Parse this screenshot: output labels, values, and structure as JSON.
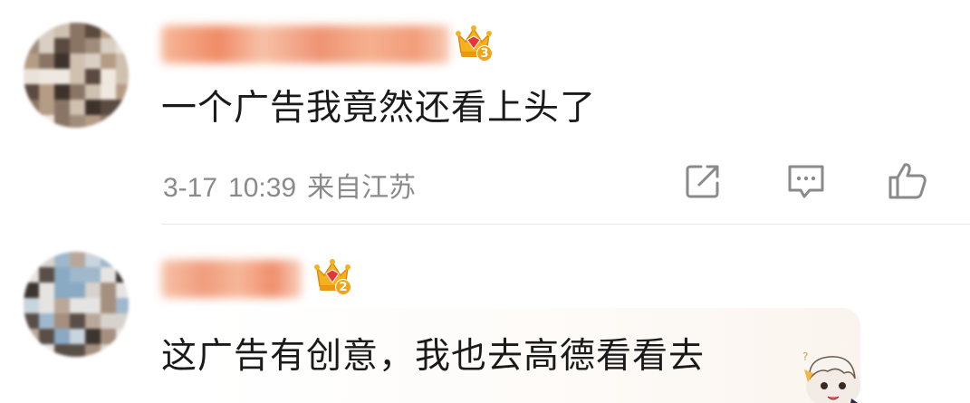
{
  "comments": [
    {
      "content": "一个广告我竟然还看上头了",
      "badge_level": "3",
      "date": "3-17",
      "time": "10:39",
      "location": "来自江苏",
      "actions": [
        "share-icon",
        "reply-icon",
        "like-icon"
      ]
    },
    {
      "content": "这广告有创意，我也去高德看看去",
      "badge_level": "2"
    }
  ],
  "colors": {
    "text_primary": "#1a1a1a",
    "text_meta": "#8a8a8a",
    "crown_gold": "#f1a31b",
    "crown_gem": "#e8323c",
    "username_blur": "#f08a66"
  }
}
